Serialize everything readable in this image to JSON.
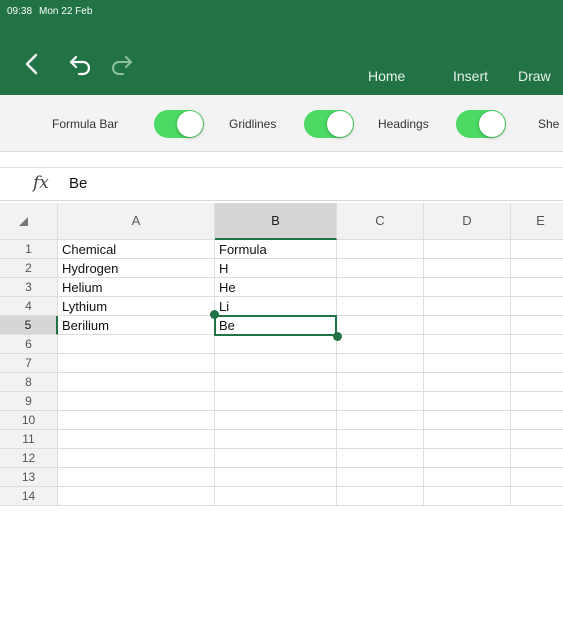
{
  "status": {
    "time": "09:38",
    "date": "Mon 22 Feb"
  },
  "tabs": [
    {
      "label": "Home"
    },
    {
      "label": "Insert"
    },
    {
      "label": "Draw"
    }
  ],
  "toolbar": {
    "toggles": [
      {
        "label": "Formula Bar",
        "on": true
      },
      {
        "label": "Gridlines",
        "on": true
      },
      {
        "label": "Headings",
        "on": true
      },
      {
        "label": "She",
        "on": true
      }
    ]
  },
  "formula_bar": {
    "fx": "fx",
    "value": "Be"
  },
  "sheet": {
    "columns": [
      "A",
      "B",
      "C",
      "D",
      "E"
    ],
    "rows": [
      "1",
      "2",
      "3",
      "4",
      "5",
      "6",
      "7",
      "8",
      "9",
      "10",
      "11",
      "12",
      "13",
      "14"
    ],
    "data": [
      [
        "Chemical",
        "Formula"
      ],
      [
        "Hydrogen",
        "H"
      ],
      [
        "Helium",
        "He"
      ],
      [
        "Lythium",
        "Li"
      ],
      [
        "Berilium",
        "Be"
      ]
    ],
    "selected_cell": "B5",
    "selected_row": "5",
    "selected_column": "B"
  },
  "colors": {
    "accent": "#217346",
    "toggle_on": "#4cd964"
  }
}
